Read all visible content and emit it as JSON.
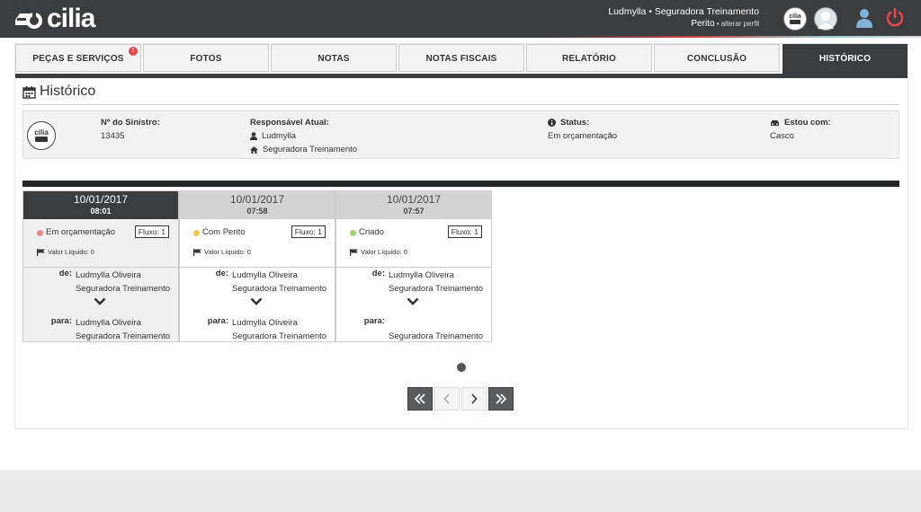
{
  "header": {
    "logo_text": "cilia",
    "user_line1": "Ludmylla • Seguradora Treinamento",
    "user_role": "Perito",
    "user_role_link": " • alterar perfil",
    "icons": [
      "cilia-badge-icon",
      "avatar-icon",
      "user-icon",
      "power-icon"
    ]
  },
  "tabs": [
    {
      "label": "PEÇAS E SERVIÇOS",
      "badge": "!"
    },
    {
      "label": "FOTOS"
    },
    {
      "label": "NOTAS"
    },
    {
      "label": "NOTAS FISCAIS"
    },
    {
      "label": "RELATÓRIO"
    },
    {
      "label": "CONCLUSÃO"
    },
    {
      "label": "HISTÓRICO"
    }
  ],
  "page": {
    "title": "Histórico"
  },
  "info": {
    "sinistro_label": "Nº do Sinistro:",
    "sinistro_value": "13435",
    "responsavel_label": "Responsável Atual:",
    "responsavel_name": "Ludmylla",
    "responsavel_company": "Seguradora Treinamento",
    "status_label": "Status:",
    "status_value": "Em orçamentação",
    "estou_label": "Estou com:",
    "estou_value": "Casco"
  },
  "cards": [
    {
      "date": "10/01/2017",
      "time": "08:01",
      "status": "Em orçamentação",
      "dot_color": "#e98a8a",
      "fluxo": "Fluxo: 1",
      "valor": "Valor Líquido: 0",
      "de_label": "de:",
      "de_name": "Ludmylla Oliveira",
      "de_company": "Seguradora Treinamento",
      "para_label": "para:",
      "para_name": "Ludmylla Oliveira",
      "para_company": "Seguradora Treinamento"
    },
    {
      "date": "10/01/2017",
      "time": "07:58",
      "status": "Com Perito",
      "dot_color": "#f5c451",
      "fluxo": "Fluxo: 1",
      "valor": "Valor Líquido: 0",
      "de_label": "de:",
      "de_name": "Ludmylla Oliveira",
      "de_company": "Seguradora Treinamento",
      "para_label": "para:",
      "para_name": "Ludmylla Oliveira",
      "para_company": "Seguradora Treinamento"
    },
    {
      "date": "10/01/2017",
      "time": "07:57",
      "status": "Criado",
      "dot_color": "#a4d36c",
      "fluxo": "Fluxo: 1",
      "valor": "Valor Líquido: 0",
      "de_label": "de:",
      "de_name": "Ludmylla Oliveira",
      "de_company": "Seguradora Treinamento",
      "para_label": "para:",
      "para_name": "",
      "para_company": "Seguradora Treinamento"
    }
  ],
  "pagination": {
    "buttons": [
      "first-page",
      "prev-page",
      "next-page",
      "last-page"
    ]
  }
}
